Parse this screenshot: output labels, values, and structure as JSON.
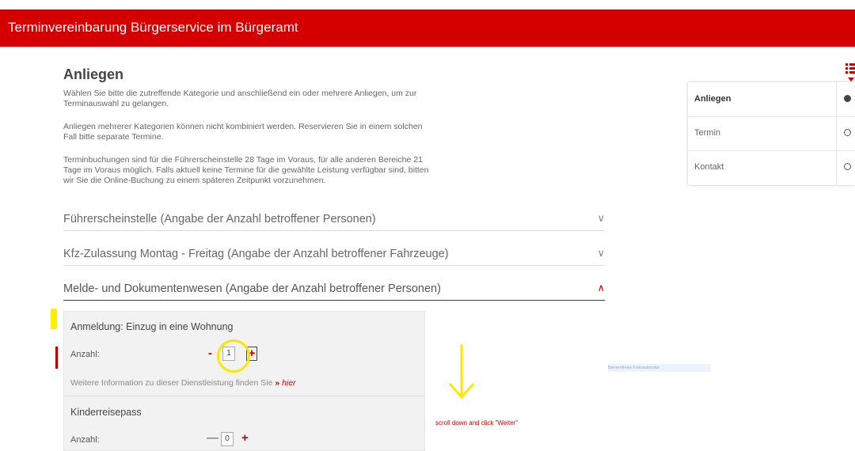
{
  "header": {
    "title": "Terminvereinbarung Bürgerservice im Bürgeramt"
  },
  "main": {
    "heading": "Anliegen",
    "paragraphs": [
      "Wählen Sie bitte die zutreffende Kategorie und anschließend ein oder mehrere Anliegen, um zur Terminauswahl zu gelangen.",
      "Anliegen mehrerer Kategorien können nicht kombiniert werden. Reservieren Sie in einem solchen Fall bitte separate Termine.",
      "Terminbuchungen sind für die Führerscheinstelle 28 Tage im Voraus, für alle anderen Bereiche 21 Tage im Voraus möglich. Falls aktuell keine Termine für die gewählte Leistung verfügbar sind, bitten wir Sie die Online-Buchung zu einem späteren Zeitpunkt vorzunehmen."
    ],
    "categories": [
      {
        "label": "Führerscheinstelle (Angabe der Anzahl betroffener Personen)",
        "chevron": "∨"
      },
      {
        "label": "Kfz-Zulassung Montag - Freitag (Angabe der Anzahl betroffener Fahrzeuge)",
        "chevron": "∨"
      },
      {
        "label": "Melde- und Dokumentenwesen (Angabe der Anzahl betroffener Personen)",
        "chevron": "∧"
      }
    ],
    "services": [
      {
        "title": "Anmeldung: Einzug in eine Wohnung",
        "count_label": "Anzahl:",
        "minus": "-",
        "value": "1",
        "plus": "+",
        "info_text": "Weitere Information zu dieser Dienstleistung finden Sie",
        "info_arrow": "»",
        "info_link": "hier"
      },
      {
        "title": "Kinderreisepass",
        "count_label": "Anzahl:",
        "minus": "—",
        "value": "0",
        "plus": "+"
      }
    ]
  },
  "annotation": {
    "text": "scroll down and click \"Weiter\""
  },
  "faint_text": "Barrierefreies Kontrastmodus",
  "stepper": {
    "steps": [
      {
        "label": "Anliegen",
        "state": "active"
      },
      {
        "label": "Termin",
        "state": "inactive"
      },
      {
        "label": "Kontakt",
        "state": "inactive"
      }
    ]
  },
  "icons": {
    "steps": "list-icon",
    "chevron": "chevron-icon",
    "arrow": "arrow-down-icon"
  },
  "colors": {
    "brand": "#d40000",
    "highlight": "#ffe600"
  }
}
